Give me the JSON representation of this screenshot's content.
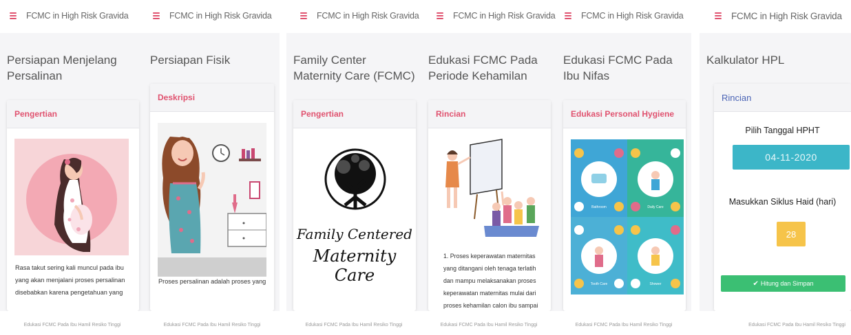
{
  "app": {
    "title": "FCMC in High Risk Gravida"
  },
  "footer": {
    "text": "Edukasi FCMC Pada Ibu Hamil Resiko Tinggi"
  },
  "screens": [
    {
      "page_title": "Persiapan Menjelang Persalinan",
      "card_header": "Pengertian",
      "illustration": "pregnant-woman-illustration",
      "text": "Rasa takut sering kali muncul pada ibu yang akan menjalani proses persalinan disebabkan karena pengetahuan yang"
    },
    {
      "page_title": "Persiapan Fisik",
      "card_header": "Deskripsi",
      "illustration": "woman-in-room-illustration",
      "text": "Proses persalinan adalah proses yang"
    },
    {
      "page_title": "Family Center Maternity Care (FCMC)",
      "card_header": "Pengertian",
      "illustration": "tree-logo",
      "logo_text_line1": "Family Centered",
      "logo_text_line2": "Maternity Care"
    },
    {
      "page_title": "Edukasi FCMC Pada Periode Kehamilan",
      "card_header": "Rincian",
      "illustration": "classroom-illustration",
      "text": "1. Proses keperawatan maternitas yang ditangani oleh tenaga terlatih dan mampu melaksanakan proses keperawatan maternitas mulai dari proses kehamilan calon ibu sampai"
    },
    {
      "page_title": "Edukasi FCMC Pada Ibu Nifas",
      "card_header": "Edukasi Personal Hygiene",
      "illustration": "personal-hygiene-infographic",
      "quadrant_labels": [
        "Bathroom",
        "Daily Care",
        "Tooth Care",
        "Shower"
      ]
    },
    {
      "page_title": "Kalkulator HPL",
      "card_header": "Rincian",
      "hpht_label": "Pilih Tanggal HPHT",
      "hpht_value": "04-11-2020",
      "cycle_label": "Masukkan Siklus Haid (hari)",
      "cycle_value": "28",
      "save_label": "Hitung dan Simpan"
    }
  ],
  "colors": {
    "accent": "#e0526f",
    "header_blue": "#4a63b5",
    "date_input": "#3cb6c8",
    "cycle_input": "#f6c44a",
    "save_button": "#3bbf73"
  }
}
